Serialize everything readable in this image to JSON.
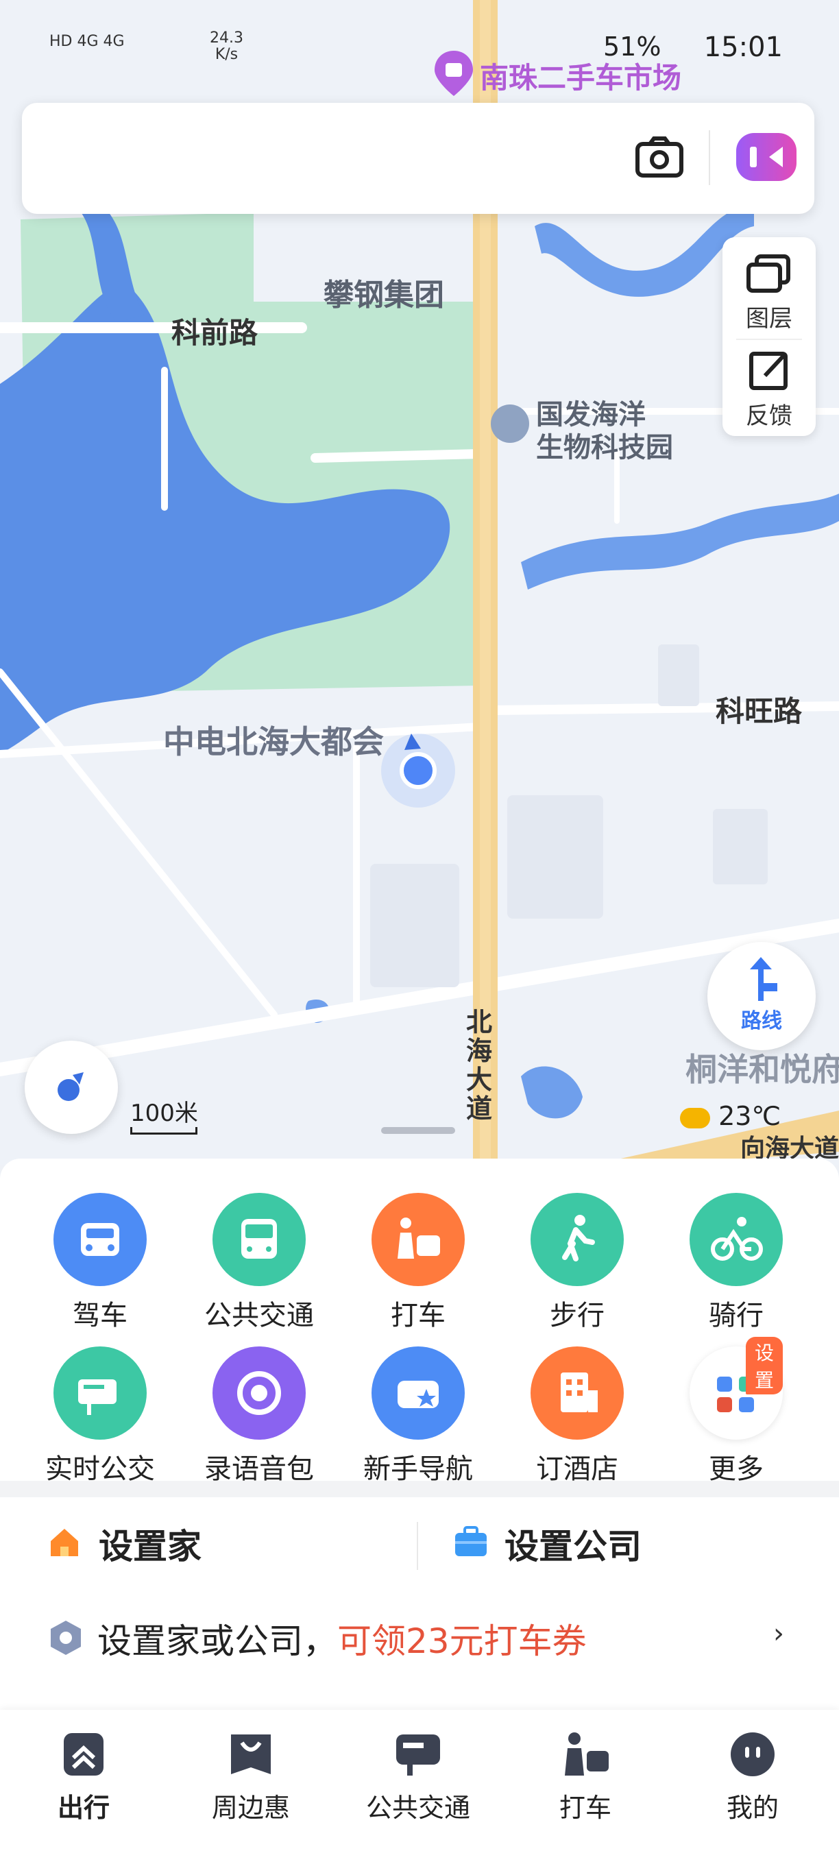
{
  "status_bar": {
    "network": "HD 4G 4G",
    "speed_value": "24.3",
    "speed_unit": "K/s",
    "battery": "51%",
    "time": "15:01"
  },
  "search": {
    "placeholder": ""
  },
  "map": {
    "poi_top": "南珠二手车市场",
    "labels": [
      "攀钢集团",
      "科前路",
      "国发海洋",
      "生物科技园",
      "中电北海大都会",
      "科旺路",
      "桐洋和悦府",
      "北",
      "海",
      "大",
      "道",
      "向海大道"
    ],
    "scale": "100米",
    "temperature": "23℃",
    "weather_icon": "cloud-rain-icon"
  },
  "side_controls": {
    "layers": "图层",
    "feedback": "反馈",
    "route": "路线"
  },
  "quick_actions": [
    {
      "label": "驾车",
      "icon": "car-icon",
      "color": "#4d8cf5"
    },
    {
      "label": "公共交通",
      "icon": "bus-icon",
      "color": "#3dc8a4"
    },
    {
      "label": "打车",
      "icon": "taxi-icon",
      "color": "#ff7a3d"
    },
    {
      "label": "步行",
      "icon": "walk-icon",
      "color": "#3dc8a4"
    },
    {
      "label": "骑行",
      "icon": "bike-icon",
      "color": "#3dc8a4"
    },
    {
      "label": "实时公交",
      "icon": "realtime-bus-icon",
      "color": "#3dc8a4"
    },
    {
      "label": "录语音包",
      "icon": "voice-pack-icon",
      "color": "#8a63f0"
    },
    {
      "label": "新手导航",
      "icon": "new-driver-icon",
      "color": "#4d8cf5"
    },
    {
      "label": "订酒店",
      "icon": "hotel-icon",
      "color": "#ff7a3d"
    },
    {
      "label": "更多",
      "icon": "more-apps-icon",
      "color": "#ffffff",
      "badge": "设置"
    }
  ],
  "places": {
    "home": "设置家",
    "company": "设置公司",
    "promo_prefix": "设置家或公司，",
    "promo_highlight": "可领23元打车券"
  },
  "bottom_nav": [
    {
      "label": "出行",
      "icon": "travel-icon",
      "active": true
    },
    {
      "label": "周边惠",
      "icon": "nearby-deals-icon",
      "active": false
    },
    {
      "label": "公共交通",
      "icon": "transit-icon",
      "active": false
    },
    {
      "label": "打车",
      "icon": "taxi-nav-icon",
      "active": false
    },
    {
      "label": "我的",
      "icon": "profile-icon",
      "active": false
    }
  ]
}
